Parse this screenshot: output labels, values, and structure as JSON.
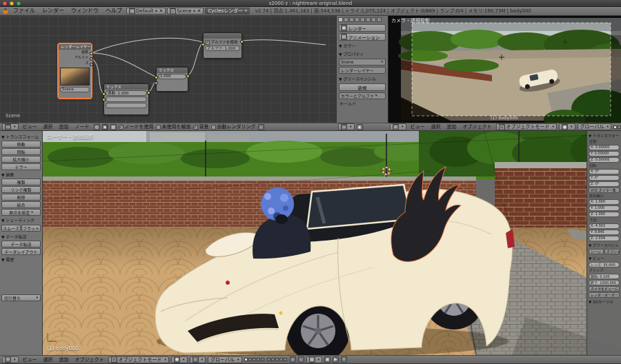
{
  "window": {
    "title": "s2000 z : nightmare original.blend"
  },
  "info_bar": {
    "menu_file": "ファイル",
    "menu_render": "レンダー",
    "menu_window": "ウィンドウ",
    "menu_help": "ヘルプ",
    "layout_value": "Default",
    "scene_value": "Scene",
    "engine_value": "Cyclesレンダー",
    "stats": "v2.74 | 頂点:1,461,163 | 面:544,536 | トライ:1,075,124 | オブジェクト:0/889 | ランプ:0/4 | メモリ:190.73M | body000"
  },
  "node_editor": {
    "scene_label": "Scene",
    "render_layers_node": {
      "title": "レンダーレイヤー",
      "out_image": "画像",
      "out_alpha": "アルファ",
      "out_z": "Z",
      "scene_field": "Scene"
    },
    "mix_node1": {
      "title": "ミックス",
      "fac_field": "係数: 1.000"
    },
    "mix_node2": {
      "title": "ミックス",
      "fac_field": "1.000"
    },
    "alpha_node": {
      "use_alpha": "アルファを使用",
      "alpha_field": "アルファ: 1.000"
    },
    "header": {
      "menu_view": "ビュー",
      "menu_select": "選択",
      "menu_add": "追加",
      "menu_node": "ノード",
      "use_nodes": "ノードを使用",
      "free_unused": "未使用を解放",
      "backdrop": "背景",
      "auto_render": "自動レンダリング"
    }
  },
  "properties_panel": {
    "render_button": "レンダー",
    "anim_button": "アニメーション",
    "section_color": "カラー",
    "section_properties": "プロパティ",
    "scene_value": "Scene",
    "render_layer_value": "レンダーレイヤー",
    "section_grease": "グリースペンシル",
    "new_button": "新規",
    "color_alpha_value": "カラーとアルファ",
    "hold_label": "ホールド"
  },
  "camera_view": {
    "view_label": "カメラ・透視投影",
    "object_label": "(1) body000",
    "header": {
      "menu_view": "ビュー",
      "menu_select": "選択",
      "menu_add": "追加",
      "menu_object": "オブジェクト",
      "mode": "オブジェクトモード",
      "orientation": "グローバル"
    }
  },
  "viewport": {
    "view_label": "ユーザー・透視投影",
    "object_label": "(1) body000",
    "header": {
      "menu_view": "ビュー",
      "menu_select": "選択",
      "menu_add": "追加",
      "menu_object": "オブジェクト",
      "mode": "オブジェクトモード",
      "orientation": "グローバル"
    }
  },
  "tool_shelf": {
    "section_transform": "トランスフォーム",
    "btn_translate": "移動",
    "btn_rotate": "回転",
    "btn_scale": "拡大縮小",
    "btn_mirror": "ミラー",
    "section_edit": "編集",
    "btn_duplicate": "複製",
    "btn_duplicate_linked": "リンク複製",
    "btn_delete": "削除",
    "btn_join": "結合",
    "btn_set_origin": "原点を設定",
    "section_shading": "シェーディング",
    "btn_smooth": "スムーズ",
    "btn_flat": "フラット",
    "section_data": "データ転送",
    "btn_data_transfer": "データ転送",
    "btn_data_layout": "データレイアウト",
    "section_history": "履歴",
    "repeat_value": "切り替え"
  },
  "n_panel": {
    "section_transform": "トランスフォーム",
    "loc_label": "位置:",
    "loc_x": "X: 0.00000",
    "loc_y": "Y: 0.00000",
    "loc_z": "Z: 0.00000",
    "rot_label": "回転:",
    "rot_x": "X: 0°",
    "rot_y": "Y: 0°",
    "rot_z": "Z: 0°",
    "rot_mode": "XYZ オイラー角",
    "scale_label": "拡大縮小:",
    "scale_x": "X: 1.000",
    "scale_y": "Y: 1.000",
    "scale_z": "Z: 1.000",
    "dim_label": "寸法:",
    "dim_x": "X: 4.302",
    "dim_y": "Y: 9.845",
    "dim_z": "Z: 2.034",
    "section_grease": "グリースペンシル",
    "btn_scene": "シーン",
    "btn_object": "オブジェクト",
    "section_view": "ビュー",
    "lens_field": "レンズ: 35.000",
    "clip_label": "クリップ:",
    "clip_start": "開始: 0.100",
    "clip_end": "終了: 1000.000",
    "lock_camera": "カメラをビューに",
    "render_border": "レンダーボーダー",
    "section_cursor": "3Dカーソル"
  }
}
